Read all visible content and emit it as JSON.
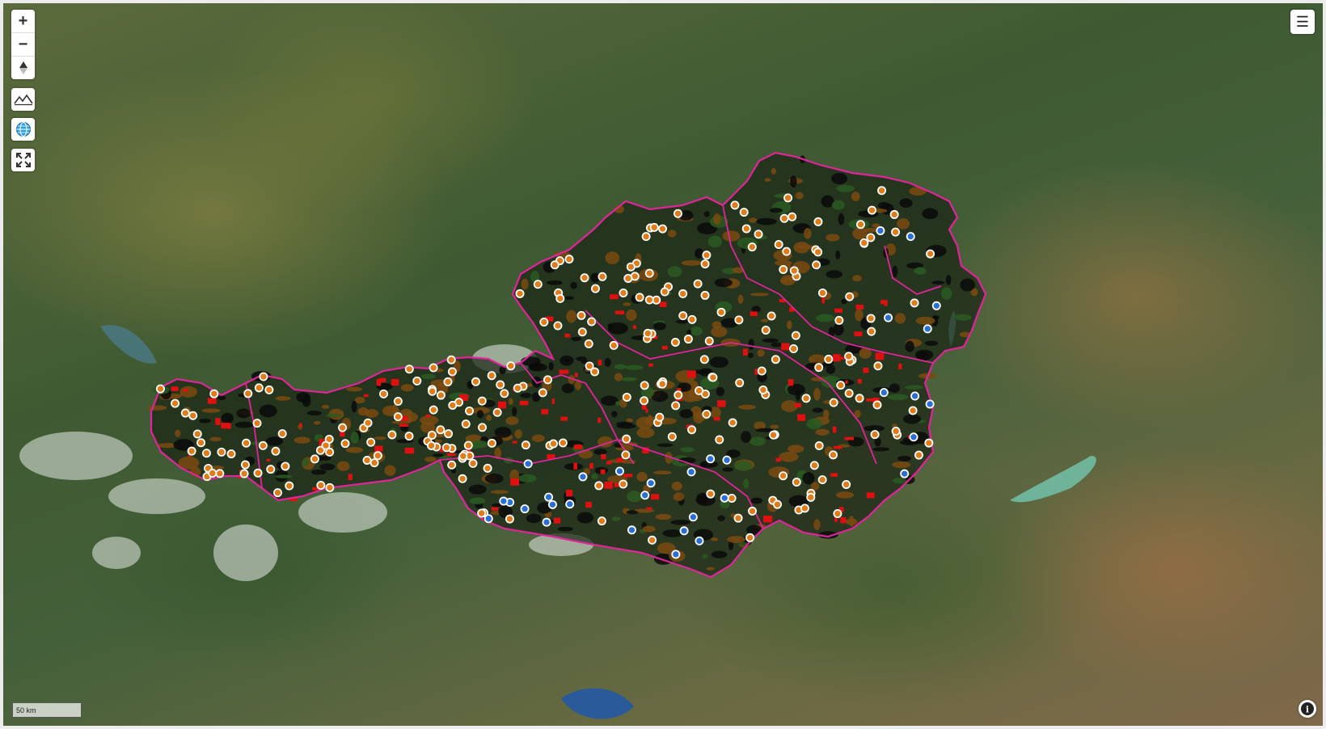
{
  "map": {
    "controls": {
      "zoom_in": "+",
      "zoom_out": "−",
      "compass": "▲",
      "terrain": "terrain-icon",
      "globe": "globe-icon",
      "fullscreen": "fullscreen-icon"
    },
    "menu_label": "☰",
    "scale_label": "50 km",
    "info_label": "i",
    "colors": {
      "boundary": "#e0249a",
      "marker_orange": "#e07b1a",
      "marker_blue": "#2a6fd6",
      "area_red": "#e01010",
      "area_brown": "#7a4a10",
      "area_dark": "#0a0a0a",
      "lake": "#6fb39a"
    }
  }
}
